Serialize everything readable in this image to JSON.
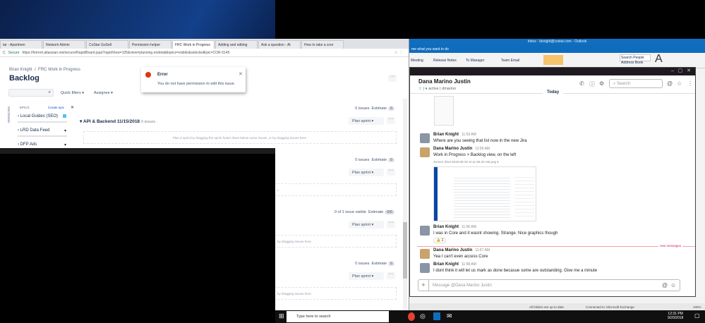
{
  "chrome": {
    "tabs": [
      "tar - Apartmen",
      "Network Admin",
      "CoStar GoSell",
      "Permission helper",
      "FRC Work in Progress",
      "Adding and editing",
      "Ask a question - At",
      "How to take a scre"
    ],
    "active_tab": 4,
    "secure_label": "Secure",
    "url": "https://forrent.atlassian.net/secure/RapidBoard.jspa?rapidView=105&view=planning.nodetail&epics=visible&selectedEpic=COR-5145"
  },
  "jira": {
    "breadcrumb": [
      "Brian Knight",
      "FRC Work in Progress"
    ],
    "page_title": "Backlog",
    "quick_filters": "Quick filters",
    "assignee": "Assignee",
    "versions_label": "VERSIONS",
    "epics_label": "EPICS",
    "create_epic": "Create epic",
    "epics": [
      "Local Guides (SEO)",
      "LRD Data Feed",
      "DFP Ads"
    ],
    "error": {
      "title": "Error",
      "message": "You do not have permission to edit this issue."
    },
    "sprints": [
      {
        "name": "API & Backend 11/15/2018",
        "count": "0 issues",
        "issues": "0 issues",
        "estimate_label": "Estimate",
        "estimate": "0",
        "plan": "Plan sprint",
        "hint": "Plan a sprint by dragging the sprint footer down below some issues, or by dragging issues here."
      },
      {
        "issues": "0 issues",
        "estimate_label": "Estimate",
        "estimate": "0",
        "plan": "Plan sprint",
        "hint": "r."
      },
      {
        "issues": "0 of 1 issue visible",
        "estimate_label": "Estimate",
        "estimate": "0/0",
        "plan": "Plan sprint",
        "hint": "by dragging issues here."
      },
      {
        "issues": "0 issues",
        "estimate_label": "Estimate",
        "estimate": "0",
        "plan": "Plan sprint",
        "hint": "by dragging issues here."
      }
    ]
  },
  "outlook": {
    "title": "Inbox - bknight@costar.com - Outlook",
    "tell_me": "me what you want to do",
    "ribbon": [
      "Meeting",
      "Release Notes",
      "To Manager",
      "Team Email",
      "Search People",
      "Address Book"
    ],
    "status_left": "All folders are up to date.",
    "status_right": "Connected to: Microsoft Exchange",
    "zoom": "100%"
  },
  "slack": {
    "contact": "Dana Marino Justin",
    "status": "active",
    "handle": "dmarino",
    "search_placeholder": "Search",
    "day": "Today",
    "new_messages": "new messages",
    "attachment": "Screen Shot 2018-09-20 at 11.55.20 AM.png",
    "reaction_count": "1",
    "messages": [
      {
        "author": "Brian Knight",
        "time": "11:53 AM",
        "text": "Where are you seeing that list now in the new Jira"
      },
      {
        "author": "Dana Marino Justin",
        "time": "11:56 AM",
        "text": "Work in Progress > Backlog view, on the left"
      },
      {
        "author": "Brian Knight",
        "time": "11:56 AM",
        "text": "I was in Core and it wasnt showing.  Strange.  Nice graphics though"
      },
      {
        "author": "Dana Marino Justin",
        "time": "11:57 AM",
        "text": "Yea I can't even access Core"
      },
      {
        "author": "Brian Knight",
        "time": "11:58 AM",
        "text": "I dont think it will let us mark as done becasue some are outstanding.  Give me a minute"
      }
    ],
    "message_placeholder": "Message @Dana Marino Justin"
  },
  "taskbar": {
    "search": "Type here to search",
    "time": "12:31 PM",
    "date": "9/20/2018"
  }
}
